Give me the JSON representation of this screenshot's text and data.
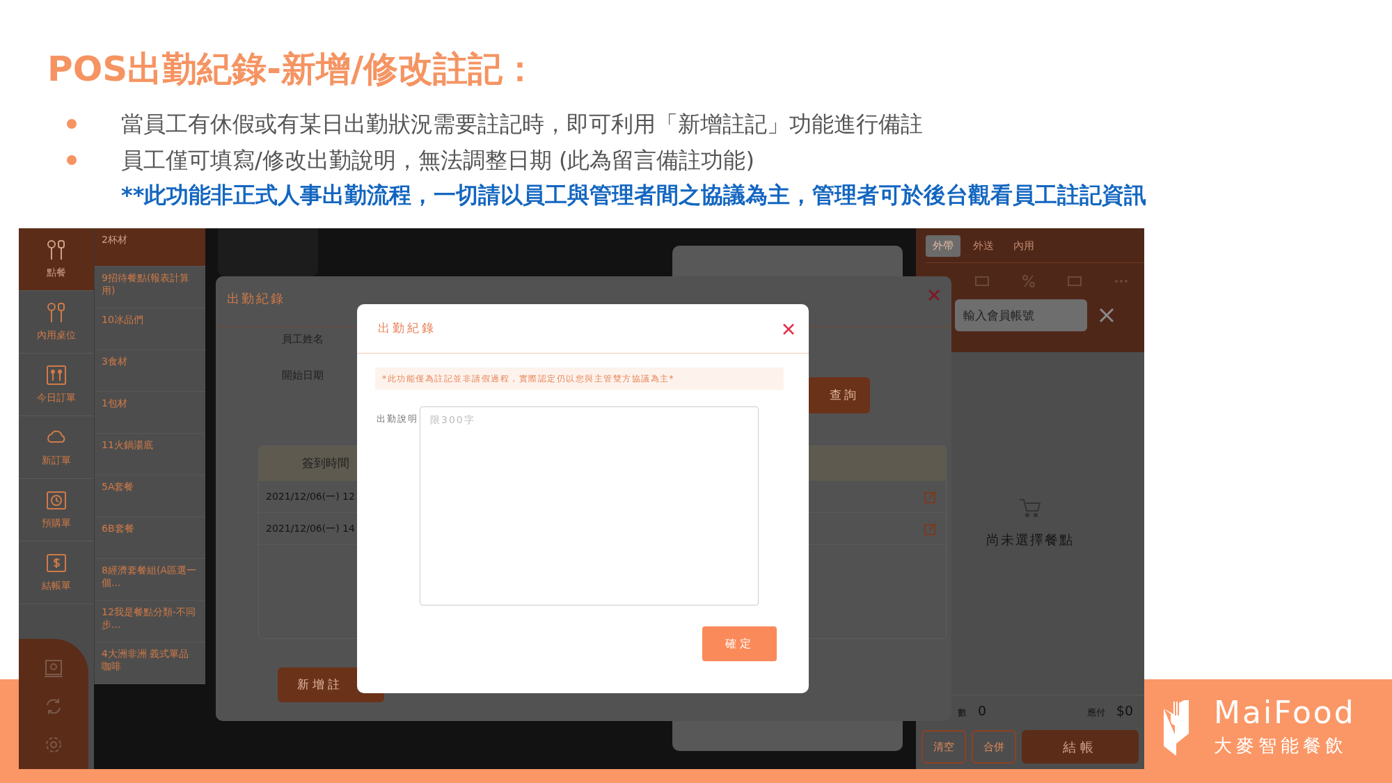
{
  "slide": {
    "title": "POS出勤紀錄-新增/修改註記：",
    "bullets": [
      {
        "text": "當員工有休假或有某日出勤狀況需要註記時，即可利用「新增註記」功能進行備註"
      },
      {
        "text": "員工僅可填寫/修改出勤說明，無法調整日期 (此為留言備註功能)"
      }
    ],
    "note": "**此功能非正式人事出勤流程，一切請以員工與管理者間之協議為主，管理者可於後台觀看員工註記資訊"
  },
  "pos_screen": {
    "sidebar": {
      "items": [
        {
          "label": "點餐",
          "kind": "utensils",
          "selected": true
        },
        {
          "label": "內用桌位",
          "kind": "utensils",
          "selected": false
        },
        {
          "label": "今日訂單",
          "kind": "menu",
          "selected": false
        },
        {
          "label": "新訂單",
          "kind": "cloud",
          "selected": false
        },
        {
          "label": "預購單",
          "kind": "clock",
          "selected": false
        },
        {
          "label": "結帳單",
          "kind": "dollar",
          "selected": false
        }
      ]
    },
    "categories": [
      {
        "label": "2杯材",
        "selected": true
      },
      {
        "label": "9招待餐點(報表計算用)",
        "selected": false
      },
      {
        "label": "10冰品們",
        "selected": false
      },
      {
        "label": "3食材",
        "selected": false
      },
      {
        "label": "1包材",
        "selected": false
      },
      {
        "label": "11火鍋湯底",
        "selected": false
      },
      {
        "label": "5A套餐",
        "selected": false
      },
      {
        "label": "6B套餐",
        "selected": false
      },
      {
        "label": "8經濟套餐組(A區選一個...",
        "selected": false
      },
      {
        "label": "12我是餐點分類-不同步...",
        "selected": false
      },
      {
        "label": "4大洲非洲 義式單品咖啡",
        "selected": false
      }
    ],
    "attendance_panel": {
      "title": "出勤紀錄",
      "fields": [
        {
          "label": "員工姓名"
        },
        {
          "label": "開始日期"
        }
      ],
      "query_button": "查詢",
      "table": {
        "columns": [
          "簽到時間"
        ],
        "rows": [
          {
            "cells": [
              "2021/12/06(一) 12"
            ]
          },
          {
            "cells": [
              "2021/12/06(一) 14"
            ]
          }
        ]
      },
      "add_note_button": "新增註"
    },
    "order_panel": {
      "tabs": [
        {
          "label": "外帶",
          "selected": true
        },
        {
          "label": "外送",
          "selected": false
        },
        {
          "label": "內用",
          "selected": false
        }
      ],
      "member_field": {
        "placeholder": "輸入會員帳號"
      },
      "empty_text": "尚未選擇餐點",
      "summary": [
        {
          "label": "數",
          "value": "0"
        },
        {
          "label": "應付",
          "value": "$0"
        }
      ],
      "buttons": [
        {
          "label": "清空",
          "kind": "outline"
        },
        {
          "label": "合併",
          "kind": "outline"
        },
        {
          "label": "結帳",
          "kind": "fill"
        }
      ]
    },
    "modal": {
      "title": "出勤紀錄",
      "notice": "*此功能僅為註記並非請假過程，實際認定仍以您與主管雙方協議為主*",
      "field_label": "出勤說明",
      "placeholder": "限300字",
      "confirm_button": "確定"
    }
  },
  "logo": {
    "name": "MaiFood",
    "tagline": "大麥智能餐飲"
  }
}
